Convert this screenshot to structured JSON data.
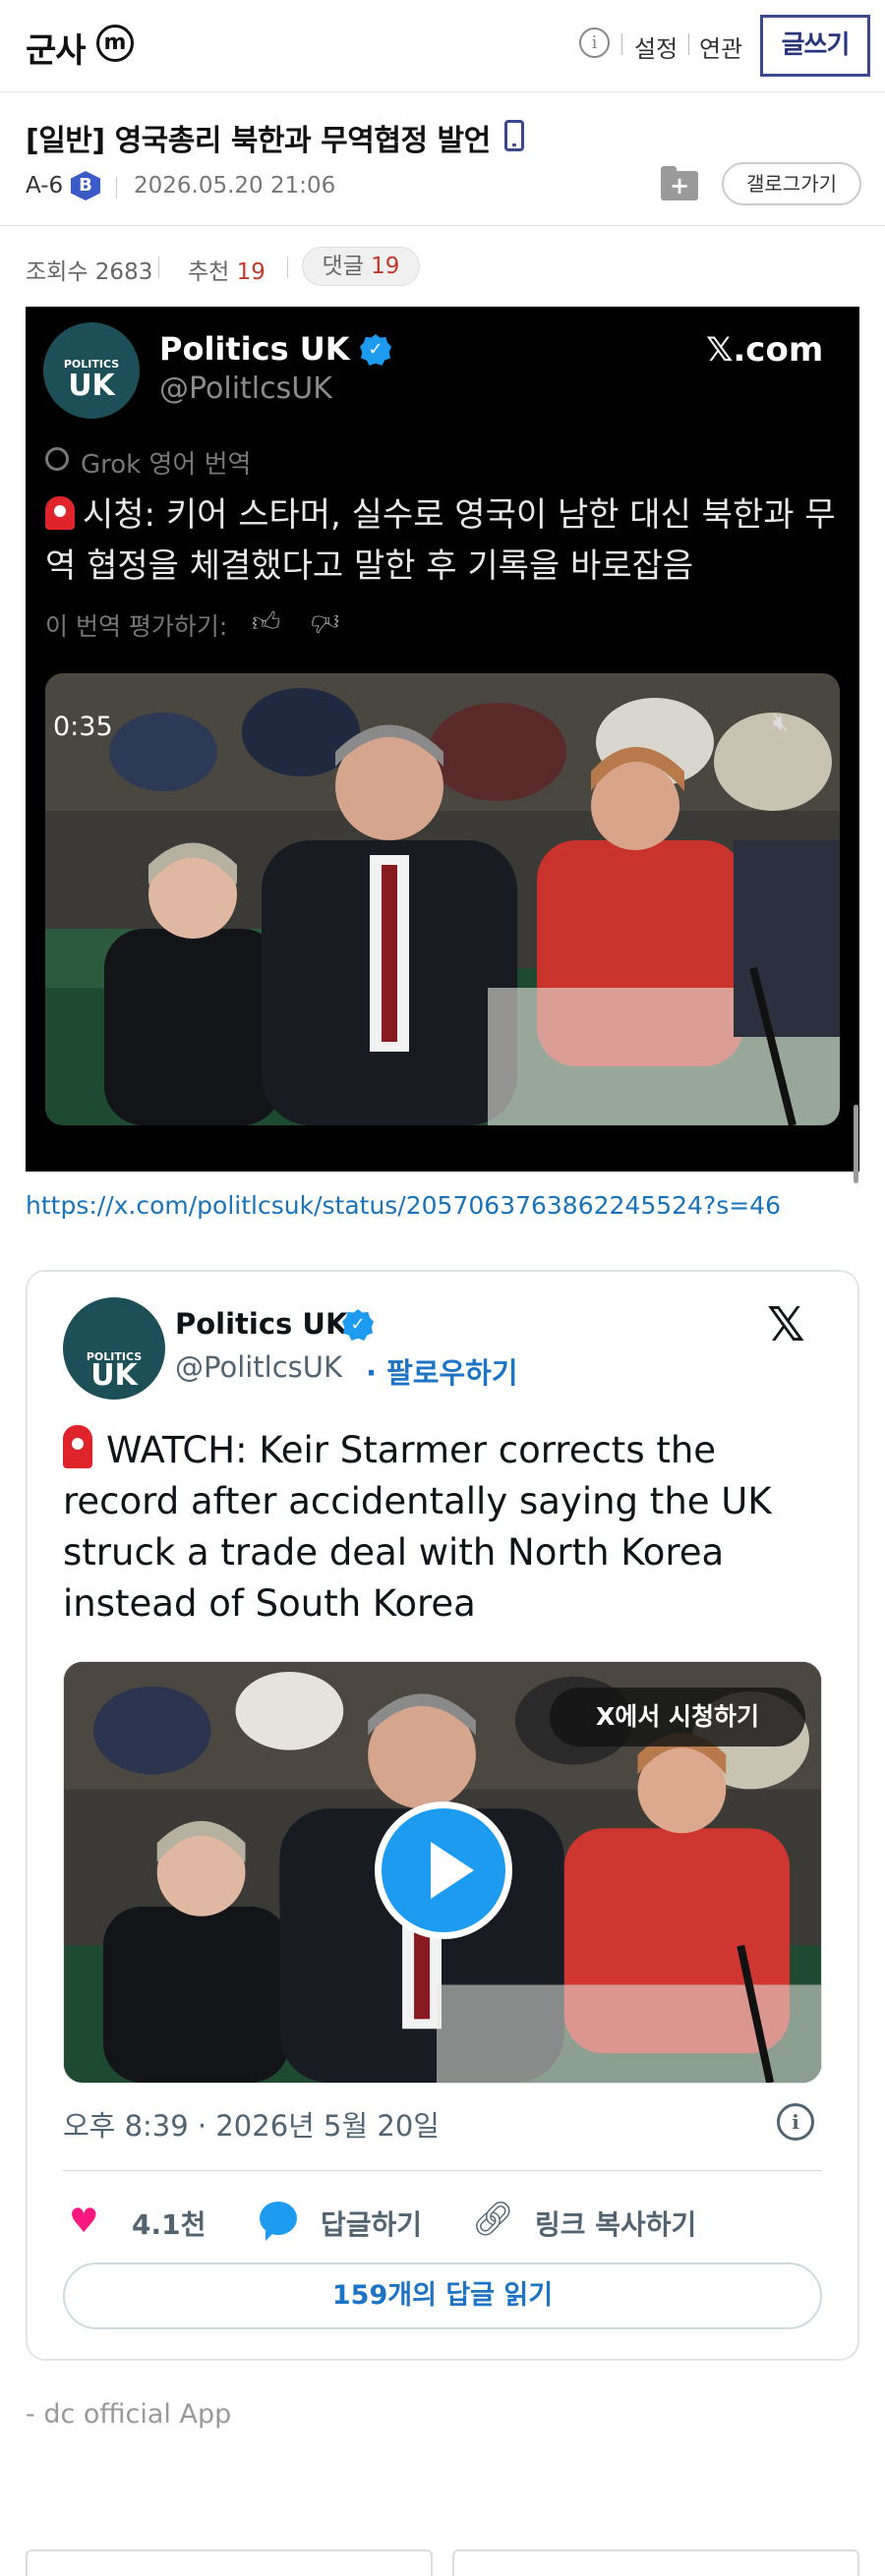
{
  "topbar": {
    "gallery_name": "군사",
    "m_badge": "m",
    "info": "i",
    "settings": "설정",
    "related": "연관",
    "write": "글쓰기"
  },
  "post": {
    "title": "[일반] 영국총리 북한과 무역협정 발언",
    "author": "A-6",
    "author_badge": "B",
    "date": "2026.05.20 21:06",
    "gallery_go": "갤로그가기",
    "folder_icon": "+",
    "views_label": "조회수",
    "views": "2683",
    "recommend_label": "추천",
    "recommend": "19",
    "comments_label": "댓글",
    "comments": "19"
  },
  "screenshot": {
    "avatar_top": "POLITICS",
    "avatar_main": "UK",
    "name": "Politics UK",
    "handle": "@PolitlcsUK",
    "site": "𝕏.com",
    "grok": "Grok 영어 번역",
    "text": "시청: 키어 스타머, 실수로 영국이 남한 대신 북한과 무역 협정을 체결했다고 말한 후 기록을 바로잡음",
    "rate": "이 번역 평가하기:",
    "video_time": "0:35"
  },
  "url": "https://x.com/politlcsuk/status/2057063763862245524?s=46",
  "card": {
    "avatar_top": "POLITICS",
    "avatar_main": "UK",
    "name": "Politics UK",
    "handle": "@PolitlcsUK",
    "follow": "· 팔로우하기",
    "x_logo": "𝕏",
    "text": "WATCH: Keir Starmer corrects the record after accidentally saying the UK struck a trade deal with North Korea instead of South Korea",
    "watch_on_x": "X에서 시청하기",
    "date": "오후 8:39 · 2026년 5월 20일",
    "info": "i",
    "likes": "4.1천",
    "reply": "답글하기",
    "copy_link": "링크 복사하기",
    "read_replies": "159개의 답글 읽기"
  },
  "footer": {
    "note": "- dc official App"
  },
  "colors": {
    "brand_navy": "#3b4890",
    "link_blue": "#1a73b8",
    "x_blue": "#1d9bf0",
    "like_pink": "#f91880",
    "count_red": "#c0392b"
  }
}
